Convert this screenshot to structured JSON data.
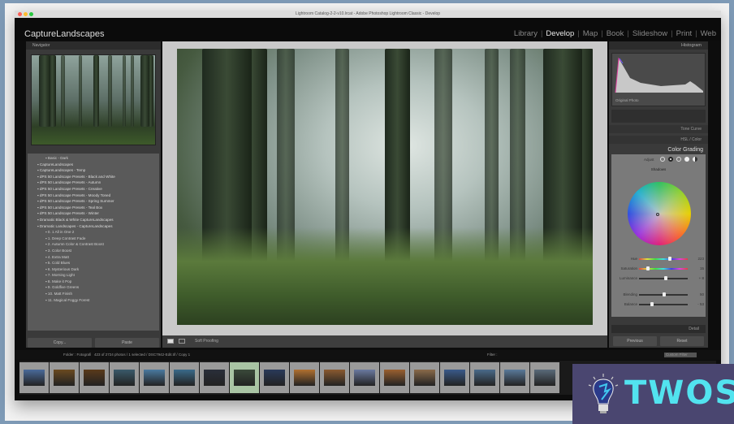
{
  "window": {
    "title": "Lightroom Catalog-2-2-v10.lrcat - Adobe Photoshop Lightroom Classic - Develop"
  },
  "identity_plate": "CaptureLandscapes",
  "modules": [
    {
      "label": "Library",
      "active": false
    },
    {
      "label": "Develop",
      "active": true
    },
    {
      "label": "Map",
      "active": false
    },
    {
      "label": "Book",
      "active": false
    },
    {
      "label": "Slideshow",
      "active": false
    },
    {
      "label": "Print",
      "active": false
    },
    {
      "label": "Web",
      "active": false
    }
  ],
  "left_panel": {
    "navigator_title": "Navigator",
    "presets": [
      {
        "label": "Basic - Dark",
        "sub": true
      },
      {
        "label": "CaptureLandscapes"
      },
      {
        "label": "CaptureLandscapes - Temp"
      },
      {
        "label": "dPS 50 Landscape Presets - Black and White"
      },
      {
        "label": "dPS 50 Landscape Presets - Autumn"
      },
      {
        "label": "dPS 50 Landscape Presets - Creative"
      },
      {
        "label": "dPS 50 Landscape Presets - Moody Toned"
      },
      {
        "label": "dPS 50 Landscape Presets - Spring Summer"
      },
      {
        "label": "dPS 50 Landscape Presets - Teal Box"
      },
      {
        "label": "dPS 50 Landscape Presets - Winter"
      },
      {
        "label": "Dramatic Black & White CaptureLandscapes"
      },
      {
        "label": "Dramatic Landscapes - CaptureLandscapes"
      },
      {
        "label": "0. 1 All in One 2",
        "sub": true
      },
      {
        "label": "1. Deep Contrast Fade",
        "sub": true
      },
      {
        "label": "2. Autumn Color & Contrast Boost",
        "sub": true
      },
      {
        "label": "3. Color Boost",
        "sub": true
      },
      {
        "label": "4. Extra Matt",
        "sub": true
      },
      {
        "label": "5. Cold Blues",
        "sub": true
      },
      {
        "label": "6. Mysterious Dark",
        "sub": true
      },
      {
        "label": "7. Morning Light",
        "sub": true
      },
      {
        "label": "8. Make it Pop",
        "sub": true
      },
      {
        "label": "9. Goldfive Greens",
        "sub": true
      },
      {
        "label": "10. Matt Finish",
        "sub": true
      },
      {
        "label": "11. Magical Foggy Forest",
        "sub": true
      }
    ],
    "copy_label": "Copy...",
    "paste_label": "Paste"
  },
  "toolbar": {
    "soft_proofing": "Soft Proofing"
  },
  "right_panel": {
    "histogram_title": "Histogram",
    "original_photo": "Original Photo",
    "tone_curve": "Tone Curve",
    "hsl": "HSL / Color",
    "color_grading": "Color Grading",
    "adjust": "Adjust",
    "mode": "Shadows",
    "sliders": [
      {
        "label": "Hue",
        "value": "223",
        "fraction": 0.62
      },
      {
        "label": "Saturation",
        "value": "15",
        "fraction": 0.15
      },
      {
        "label": "Luminance",
        "value": "+ 8",
        "fraction": 0.54
      }
    ],
    "sliders2": [
      {
        "label": "Blending",
        "value": "50",
        "fraction": 0.5
      },
      {
        "label": "Balance",
        "value": "- 53",
        "fraction": 0.24
      }
    ],
    "detail": "Detail",
    "previous_label": "Previous",
    "reset_label": "Reset"
  },
  "filmstrip": {
    "folder": "Folder : Fotografi",
    "count": "423 of 2724 photos / 1 selected / DSC7942-Edit.tif / Copy 1",
    "filter_label": "Filter :",
    "custom_filter": "Custom Filter",
    "thumbs": [
      "#4a6a9a",
      "#6a4a20",
      "#5a3a1a",
      "#3a5a6a",
      "#4a7aa0",
      "#3a6a8a",
      "#2a2f3a",
      "#3a4a3a",
      "#2a3a5a",
      "#b07030",
      "#8a5a30",
      "#6a7aa0",
      "#9a6030",
      "#8a6a4a",
      "#3a5a8a",
      "#4a6a8a",
      "#5a7a9a",
      "#5a6a7a"
    ],
    "selected_index": 7
  },
  "watermark": {
    "text": "TWOS",
    "bg": "#4a4670",
    "color": "#52e3ef"
  }
}
